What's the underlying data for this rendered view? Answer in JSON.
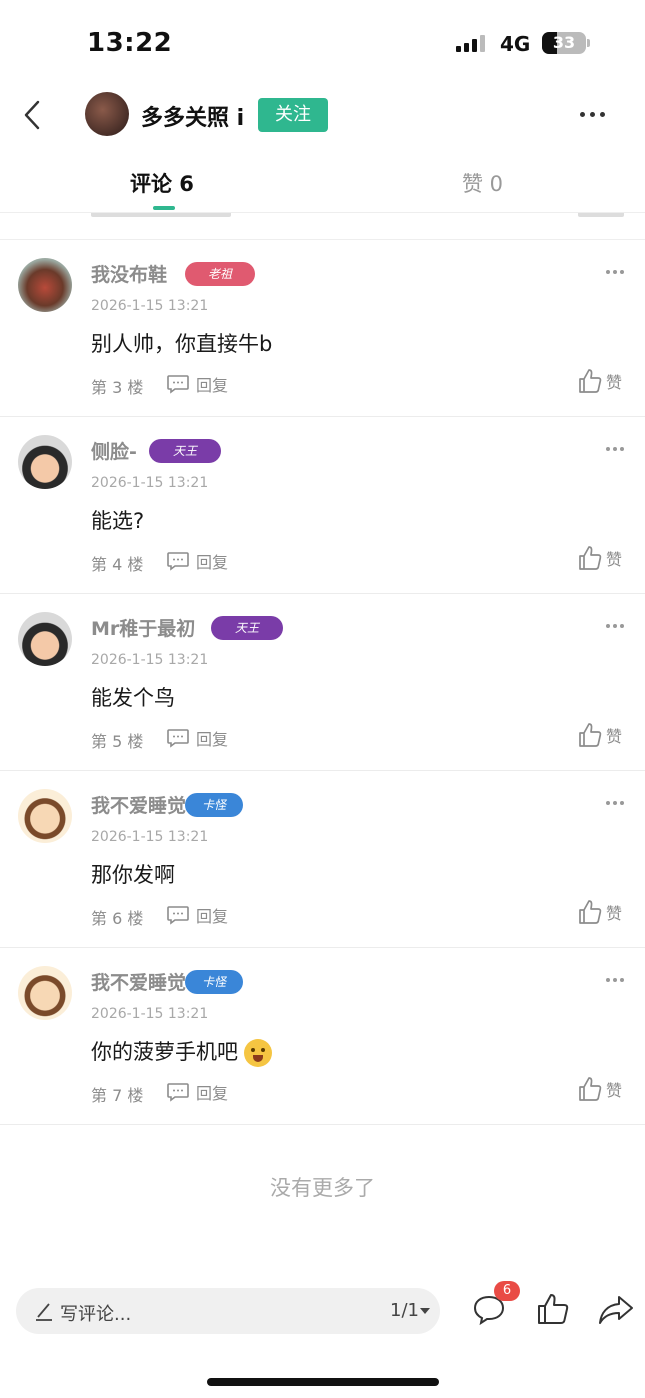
{
  "status_bar": {
    "time": "13:22",
    "network": "4G",
    "battery": "33",
    "battery_level": 0.33
  },
  "header": {
    "username": "多多关照 i",
    "follow_label": "关注"
  },
  "tabs": [
    {
      "label": "评论 6"
    },
    {
      "label": "赞 0"
    }
  ],
  "colors": {
    "accent": "#2fb78f",
    "badge_red": "#e94b45"
  },
  "comments": [
    {
      "name": "我没布鞋",
      "badge": "老祖",
      "badge_color": "#e05a70",
      "time": "2026-1-15 13:21",
      "text": "别人帅，你直接牛b",
      "floor": "第 3 楼",
      "reply": "回复",
      "like": "赞",
      "avatar": "photo-avatar"
    },
    {
      "name": "侧脸-",
      "badge": "天王",
      "badge_color": "#7a3ca8",
      "time": "2026-1-15 13:21",
      "text": "能选?",
      "floor": "第 4 楼",
      "reply": "回复",
      "like": "赞",
      "avatar": "cartoon-avatar"
    },
    {
      "name": "Mr稚于最初",
      "badge": "天王",
      "badge_color": "#7a3ca8",
      "time": "2026-1-15 13:21",
      "text": "能发个鸟",
      "floor": "第 5 楼",
      "reply": "回复",
      "like": "赞",
      "avatar": "cartoon-avatar"
    },
    {
      "name": "我不爱睡觉",
      "badge": "卡怪",
      "badge_color": "#3a86d8",
      "time": "2026-1-15 13:21",
      "text": "那你发啊",
      "floor": "第 6 楼",
      "reply": "回复",
      "like": "赞",
      "avatar": "cartoon-boy-avatar"
    },
    {
      "name": "我不爱睡觉",
      "badge": "卡怪",
      "badge_color": "#3a86d8",
      "time": "2026-1-15 13:21",
      "text": "你的菠萝手机吧",
      "floor": "第 7 楼",
      "reply": "回复",
      "like": "赞",
      "avatar": "cartoon-boy-avatar",
      "emoji": "drooling-emoji"
    }
  ],
  "end_text": "没有更多了",
  "bottom_bar": {
    "placeholder": "写评论...",
    "page": "1/1",
    "comment_count": "6"
  }
}
